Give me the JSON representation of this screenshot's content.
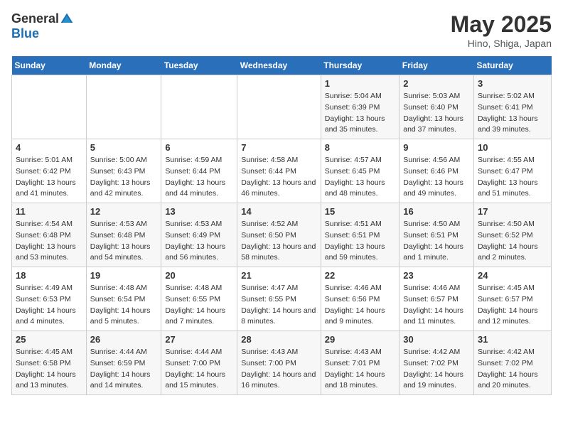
{
  "header": {
    "logo_general": "General",
    "logo_blue": "Blue",
    "title": "May 2025",
    "subtitle": "Hino, Shiga, Japan"
  },
  "columns": [
    "Sunday",
    "Monday",
    "Tuesday",
    "Wednesday",
    "Thursday",
    "Friday",
    "Saturday"
  ],
  "weeks": [
    [
      {
        "day": "",
        "sunrise": "",
        "sunset": "",
        "daylight": ""
      },
      {
        "day": "",
        "sunrise": "",
        "sunset": "",
        "daylight": ""
      },
      {
        "day": "",
        "sunrise": "",
        "sunset": "",
        "daylight": ""
      },
      {
        "day": "",
        "sunrise": "",
        "sunset": "",
        "daylight": ""
      },
      {
        "day": "1",
        "sunrise": "Sunrise: 5:04 AM",
        "sunset": "Sunset: 6:39 PM",
        "daylight": "Daylight: 13 hours and 35 minutes."
      },
      {
        "day": "2",
        "sunrise": "Sunrise: 5:03 AM",
        "sunset": "Sunset: 6:40 PM",
        "daylight": "Daylight: 13 hours and 37 minutes."
      },
      {
        "day": "3",
        "sunrise": "Sunrise: 5:02 AM",
        "sunset": "Sunset: 6:41 PM",
        "daylight": "Daylight: 13 hours and 39 minutes."
      }
    ],
    [
      {
        "day": "4",
        "sunrise": "Sunrise: 5:01 AM",
        "sunset": "Sunset: 6:42 PM",
        "daylight": "Daylight: 13 hours and 41 minutes."
      },
      {
        "day": "5",
        "sunrise": "Sunrise: 5:00 AM",
        "sunset": "Sunset: 6:43 PM",
        "daylight": "Daylight: 13 hours and 42 minutes."
      },
      {
        "day": "6",
        "sunrise": "Sunrise: 4:59 AM",
        "sunset": "Sunset: 6:44 PM",
        "daylight": "Daylight: 13 hours and 44 minutes."
      },
      {
        "day": "7",
        "sunrise": "Sunrise: 4:58 AM",
        "sunset": "Sunset: 6:44 PM",
        "daylight": "Daylight: 13 hours and 46 minutes."
      },
      {
        "day": "8",
        "sunrise": "Sunrise: 4:57 AM",
        "sunset": "Sunset: 6:45 PM",
        "daylight": "Daylight: 13 hours and 48 minutes."
      },
      {
        "day": "9",
        "sunrise": "Sunrise: 4:56 AM",
        "sunset": "Sunset: 6:46 PM",
        "daylight": "Daylight: 13 hours and 49 minutes."
      },
      {
        "day": "10",
        "sunrise": "Sunrise: 4:55 AM",
        "sunset": "Sunset: 6:47 PM",
        "daylight": "Daylight: 13 hours and 51 minutes."
      }
    ],
    [
      {
        "day": "11",
        "sunrise": "Sunrise: 4:54 AM",
        "sunset": "Sunset: 6:48 PM",
        "daylight": "Daylight: 13 hours and 53 minutes."
      },
      {
        "day": "12",
        "sunrise": "Sunrise: 4:53 AM",
        "sunset": "Sunset: 6:48 PM",
        "daylight": "Daylight: 13 hours and 54 minutes."
      },
      {
        "day": "13",
        "sunrise": "Sunrise: 4:53 AM",
        "sunset": "Sunset: 6:49 PM",
        "daylight": "Daylight: 13 hours and 56 minutes."
      },
      {
        "day": "14",
        "sunrise": "Sunrise: 4:52 AM",
        "sunset": "Sunset: 6:50 PM",
        "daylight": "Daylight: 13 hours and 58 minutes."
      },
      {
        "day": "15",
        "sunrise": "Sunrise: 4:51 AM",
        "sunset": "Sunset: 6:51 PM",
        "daylight": "Daylight: 13 hours and 59 minutes."
      },
      {
        "day": "16",
        "sunrise": "Sunrise: 4:50 AM",
        "sunset": "Sunset: 6:51 PM",
        "daylight": "Daylight: 14 hours and 1 minute."
      },
      {
        "day": "17",
        "sunrise": "Sunrise: 4:50 AM",
        "sunset": "Sunset: 6:52 PM",
        "daylight": "Daylight: 14 hours and 2 minutes."
      }
    ],
    [
      {
        "day": "18",
        "sunrise": "Sunrise: 4:49 AM",
        "sunset": "Sunset: 6:53 PM",
        "daylight": "Daylight: 14 hours and 4 minutes."
      },
      {
        "day": "19",
        "sunrise": "Sunrise: 4:48 AM",
        "sunset": "Sunset: 6:54 PM",
        "daylight": "Daylight: 14 hours and 5 minutes."
      },
      {
        "day": "20",
        "sunrise": "Sunrise: 4:48 AM",
        "sunset": "Sunset: 6:55 PM",
        "daylight": "Daylight: 14 hours and 7 minutes."
      },
      {
        "day": "21",
        "sunrise": "Sunrise: 4:47 AM",
        "sunset": "Sunset: 6:55 PM",
        "daylight": "Daylight: 14 hours and 8 minutes."
      },
      {
        "day": "22",
        "sunrise": "Sunrise: 4:46 AM",
        "sunset": "Sunset: 6:56 PM",
        "daylight": "Daylight: 14 hours and 9 minutes."
      },
      {
        "day": "23",
        "sunrise": "Sunrise: 4:46 AM",
        "sunset": "Sunset: 6:57 PM",
        "daylight": "Daylight: 14 hours and 11 minutes."
      },
      {
        "day": "24",
        "sunrise": "Sunrise: 4:45 AM",
        "sunset": "Sunset: 6:57 PM",
        "daylight": "Daylight: 14 hours and 12 minutes."
      }
    ],
    [
      {
        "day": "25",
        "sunrise": "Sunrise: 4:45 AM",
        "sunset": "Sunset: 6:58 PM",
        "daylight": "Daylight: 14 hours and 13 minutes."
      },
      {
        "day": "26",
        "sunrise": "Sunrise: 4:44 AM",
        "sunset": "Sunset: 6:59 PM",
        "daylight": "Daylight: 14 hours and 14 minutes."
      },
      {
        "day": "27",
        "sunrise": "Sunrise: 4:44 AM",
        "sunset": "Sunset: 7:00 PM",
        "daylight": "Daylight: 14 hours and 15 minutes."
      },
      {
        "day": "28",
        "sunrise": "Sunrise: 4:43 AM",
        "sunset": "Sunset: 7:00 PM",
        "daylight": "Daylight: 14 hours and 16 minutes."
      },
      {
        "day": "29",
        "sunrise": "Sunrise: 4:43 AM",
        "sunset": "Sunset: 7:01 PM",
        "daylight": "Daylight: 14 hours and 18 minutes."
      },
      {
        "day": "30",
        "sunrise": "Sunrise: 4:42 AM",
        "sunset": "Sunset: 7:02 PM",
        "daylight": "Daylight: 14 hours and 19 minutes."
      },
      {
        "day": "31",
        "sunrise": "Sunrise: 4:42 AM",
        "sunset": "Sunset: 7:02 PM",
        "daylight": "Daylight: 14 hours and 20 minutes."
      }
    ]
  ]
}
